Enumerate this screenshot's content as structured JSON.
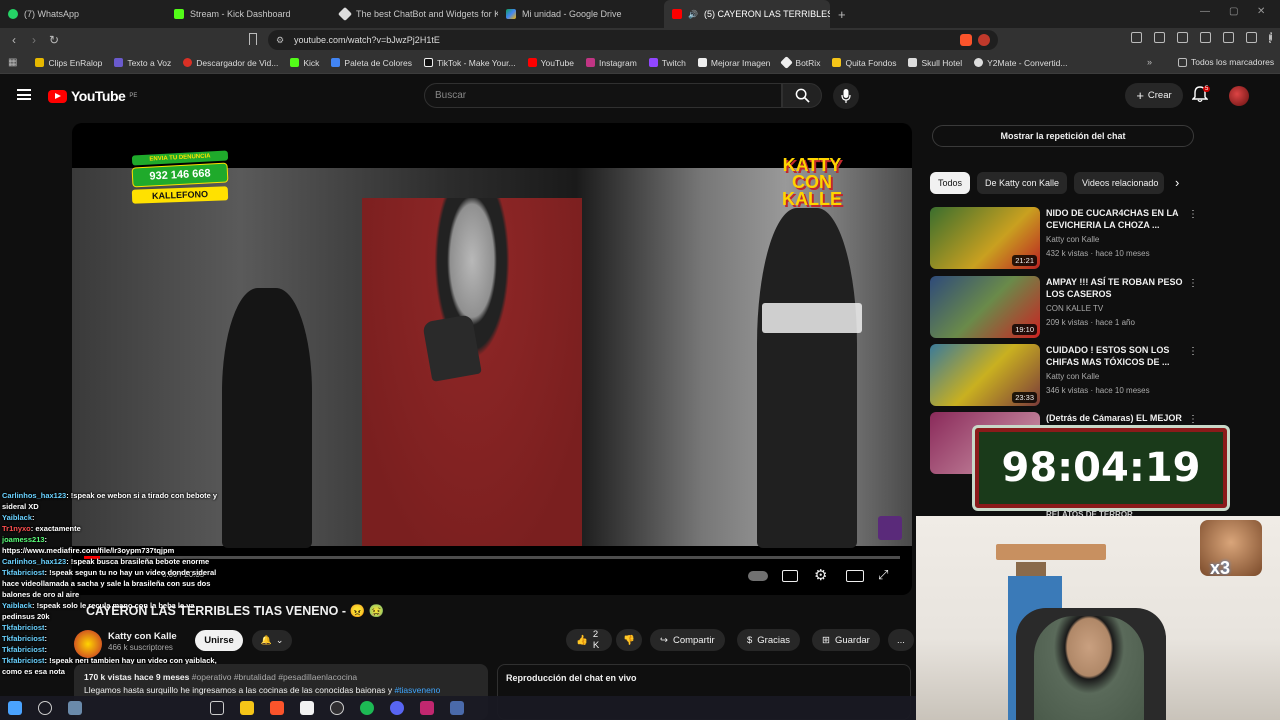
{
  "browser": {
    "tabs": [
      {
        "label": "(7) WhatsApp",
        "color": "#25d366",
        "active": false
      },
      {
        "label": "Stream - Kick Dashboard",
        "color": "#53fc18",
        "active": false
      },
      {
        "label": "The best ChatBot and Widgets for Ki",
        "color": "#dddddd",
        "active": false
      },
      {
        "label": "Mi unidad - Google Drive",
        "color": "#4285f4",
        "active": false
      },
      {
        "label": "(5) CAYERON LAS TERRIBLES",
        "color": "#ff0000",
        "active": true
      }
    ],
    "new_tab": "+",
    "url": "youtube.com/watch?v=bJwzPj2H1tE",
    "bookmarks": [
      {
        "label": "Clips EnRalop",
        "color": "#e6b800"
      },
      {
        "label": "Texto a Voz",
        "color": "#6a5acd"
      },
      {
        "label": "Descargador de Vid...",
        "color": "#d93025"
      },
      {
        "label": "Kick",
        "color": "#53fc18"
      },
      {
        "label": "Paleta de Colores",
        "color": "#4285f4"
      },
      {
        "label": "TikTok - Make Your...",
        "color": "#111111"
      },
      {
        "label": "YouTube",
        "color": "#ff0000"
      },
      {
        "label": "Instagram",
        "color": "#c13584"
      },
      {
        "label": "Twitch",
        "color": "#9146ff"
      },
      {
        "label": "Mejorar Imagen",
        "color": "#eeeeee"
      },
      {
        "label": "BotRix",
        "color": "#222222"
      },
      {
        "label": "Quita Fondos",
        "color": "#f5c518"
      },
      {
        "label": "Skull Hotel",
        "color": "#dddddd"
      },
      {
        "label": "Y2Mate - Convertid...",
        "color": "#dddddd"
      }
    ],
    "all_bookmarks": "Todos los marcadores"
  },
  "youtube": {
    "logo": "YouTube",
    "region": "PE",
    "search_placeholder": "Buscar",
    "create_label": "Crear",
    "notif_count": "5"
  },
  "video": {
    "title": "CAYERON LAS TERRIBLES TIAS VENENO - 😠 🤢",
    "channel": "Katty con Kalle",
    "subscribers": "466 k suscriptores",
    "join_label": "Unirse",
    "likes": "2 K",
    "share_label": "Compartir",
    "thanks_label": "Gracias",
    "save_label": "Guardar",
    "more": "...",
    "time_display": "0:00 / 20:35",
    "progress_fraction": 0.02,
    "overlay_phone": "932 146 668",
    "overlay_denuncia": "ENVIA TU DENUNCIA",
    "overlay_brand": "KALLEFONO",
    "overlay_logo": "KATTY CON KALLE",
    "description_meta": "170 k vistas  hace 9 meses",
    "description_tags": "#operativo #brutalidad #pesadillaenlacocina",
    "description_text": "Llegamos hasta surquillo he ingresamos a las cocinas de las conocidas baionas y",
    "description_tag2": "#tiasveneno",
    "chat_replay_title": "Reproducción del chat en vivo"
  },
  "sidebar": {
    "show_chat": "Mostrar la repetición del chat",
    "chips": [
      "Todos",
      "De Katty con Kalle",
      "Videos relacionado"
    ],
    "related": [
      {
        "title": "NIDO DE CUCAR4CHAS EN LA CEVICHERIA LA CHOZA ...",
        "channel": "Katty con Kalle",
        "meta": "432 k vistas · hace 10 meses",
        "duration": "21:21",
        "thumb": "#3a6e2e"
      },
      {
        "title": "AMPAY !!! ASÍ TE ROBAN PESO LOS CASEROS",
        "channel": "CON KALLE TV",
        "meta": "209 k vistas · hace 1 año",
        "duration": "19:10",
        "thumb": "#2e4a7a"
      },
      {
        "title": "CUIDADO ! ESTOS SON LOS CHIFAS MAS TÓXICOS DE ...",
        "channel": "Katty con Kalle",
        "meta": "346 k vistas · hace 10 meses",
        "duration": "23:33",
        "thumb": "#3a7a9a"
      },
      {
        "title": "(Detrás de Cámaras) EL MEJOR",
        "channel": "",
        "meta": "",
        "duration": "",
        "thumb": "#8a2a5a"
      }
    ],
    "partial_title": "RELATOS DE TERROR"
  },
  "stream": {
    "timer": "98:04:19",
    "multiplier": "x3",
    "chat": [
      {
        "user": "Carlinhos_hax123",
        "text": ": !speak oe webon si a tirado con bebote y sideral XD"
      },
      {
        "user": "Yaiblack",
        "text": ":"
      },
      {
        "user": "Tr1nyxo",
        "text": ": exactamente"
      },
      {
        "user": "joamess213",
        "text": ":"
      },
      {
        "user": "",
        "text": "https://www.mediafire.com/file/lr3oypm737tqjpm"
      },
      {
        "user": "Carlinhos_hax123",
        "text": ": !speak busca brasileña bebote enorme"
      },
      {
        "user": "Tkfabriciost",
        "text": ": !speak segun tu no hay un video donde sideral hace videollamada a sacha y sale la brasileña con sus dos balones de oro al aire"
      },
      {
        "user": "Yaiblack",
        "text": ": !speak solo le recula mano con la beba le va pedinsus 20k"
      },
      {
        "user": "Tkfabriciost",
        "text": ":"
      },
      {
        "user": "Tkfabriciost",
        "text": ":"
      },
      {
        "user": "Tkfabriciost",
        "text": ":"
      },
      {
        "user": "Tkfabriciost",
        "text": ": !speak neri tambien hay un video con yaiblack, como es esa nota"
      }
    ]
  }
}
